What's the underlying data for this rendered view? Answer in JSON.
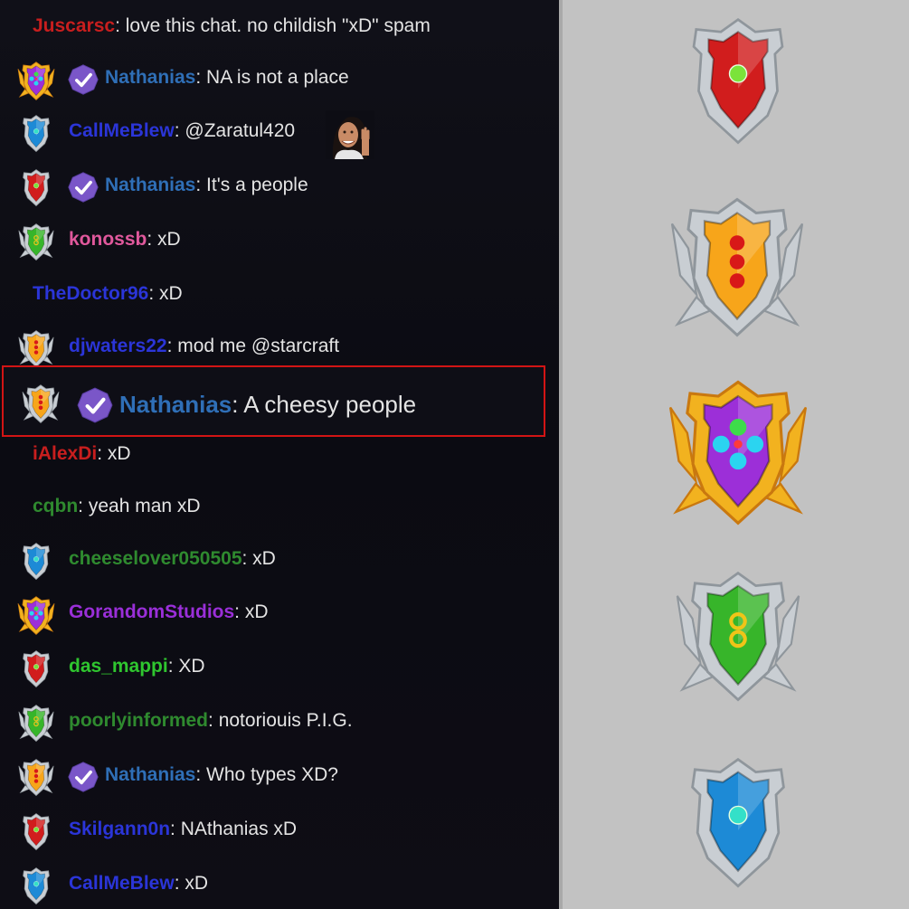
{
  "messages": [
    {
      "user": "Juscarsc",
      "text": "love this chat. no childish \"xD\" spam",
      "color": "#c81e1e",
      "badge": "",
      "verified": false
    },
    {
      "user": "Nathanias",
      "text": "NA is not a place",
      "color": "#2f6fb7",
      "badge": "purple",
      "verified": true
    },
    {
      "user": "CallMeBlew",
      "text": "@Zaratul420",
      "color": "#2b35d8",
      "badge": "blue",
      "verified": false,
      "emote": true
    },
    {
      "user": "Nathanias",
      "text": "It's a people",
      "color": "#2f6fb7",
      "badge": "red",
      "verified": true
    },
    {
      "user": "konossb",
      "text": "xD",
      "color": "#e0589c",
      "badge": "green",
      "verified": false
    },
    {
      "user": "TheDoctor96",
      "text": "xD",
      "color": "#2b35d8",
      "badge": "",
      "verified": false
    },
    {
      "user": "djwaters22",
      "text": "mod me @starcraft",
      "color": "#2b35d8",
      "badge": "orange",
      "verified": false
    },
    {
      "user": "Nathanias",
      "text": "A cheesy people",
      "color": "#2f6fb7",
      "badge": "orange",
      "verified": true,
      "highlight": true
    },
    {
      "user": "iAlexDi",
      "text": "xD",
      "color": "#c81e1e",
      "badge": "",
      "verified": false
    },
    {
      "user": "cqbn",
      "text": "yeah man xD",
      "color": "#2f8a2f",
      "badge": "",
      "verified": false
    },
    {
      "user": "cheeselover050505",
      "text": "xD",
      "color": "#2f8a2f",
      "badge": "blue",
      "verified": false
    },
    {
      "user": "GorandomStudios",
      "text": "xD",
      "color": "#9a2fd8",
      "badge": "purple",
      "verified": false
    },
    {
      "user": "das_mappi",
      "text": "XD",
      "color": "#2fc62f",
      "badge": "red",
      "verified": false
    },
    {
      "user": "poorlyinformed",
      "text": "notoriouis P.I.G.",
      "color": "#2f8a2f",
      "badge": "green",
      "verified": false
    },
    {
      "user": "Nathanias",
      "text": "Who types XD?",
      "color": "#2f6fb7",
      "badge": "orange",
      "verified": true
    },
    {
      "user": "Skilgann0n",
      "text": "NAthanias xD",
      "color": "#2b35d8",
      "badge": "red",
      "verified": false
    },
    {
      "user": "CallMeBlew",
      "text": "xD",
      "color": "#2b35d8",
      "badge": "blue",
      "verified": false
    }
  ],
  "separator": ":",
  "legend_badges": [
    "red",
    "orange",
    "purple",
    "green",
    "blue"
  ],
  "badge_colors": {
    "red": "#d11d1d",
    "orange": "#f7a51a",
    "purple": "#9c2fd8",
    "green": "#37b52a",
    "blue": "#1d8ad6"
  },
  "verified_color": "#7a56c8",
  "highlight_border": "#d21414"
}
